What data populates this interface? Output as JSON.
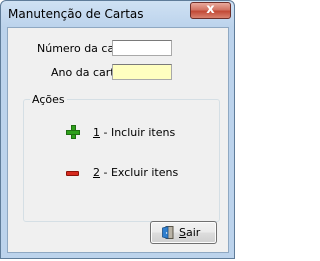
{
  "window": {
    "title": "Manutenção de Cartas",
    "close_glyph": "x"
  },
  "form": {
    "numero_label": "Número da carta",
    "numero_value": "",
    "ano_label": "Ano da carta",
    "ano_value": "",
    "ano_bg_color": "#ffffc0"
  },
  "acoes": {
    "title": "Ações",
    "incluir": {
      "key": "1",
      "rest": " - Incluir itens",
      "icon": "plus-icon",
      "color": "#2ea01b"
    },
    "excluir": {
      "key": "2",
      "rest": " - Excluir itens",
      "icon": "minus-icon",
      "color": "#d62a1e"
    }
  },
  "sair": {
    "key": "S",
    "rest": "air",
    "icon": "door-exit-icon"
  }
}
